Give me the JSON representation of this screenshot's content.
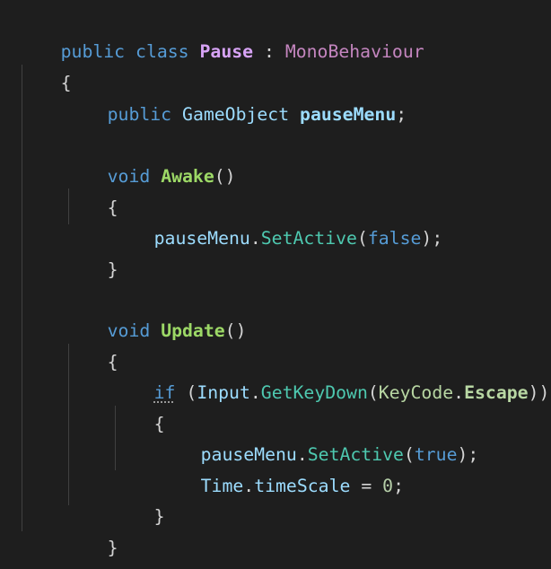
{
  "code": {
    "l1": {
      "t1": "public",
      "t2": "class",
      "t3": "Pause",
      "t4": ":",
      "t5": "MonoBehaviour"
    },
    "l2": {
      "t1": "{"
    },
    "l3": {
      "t1": "public",
      "t2": "GameObject",
      "t3": "pauseMenu",
      "t4": ";"
    },
    "l5": {
      "t1": "void",
      "t2": "Awake",
      "t3": "()"
    },
    "l6": {
      "t1": "{"
    },
    "l7": {
      "t1": "pauseMenu",
      "t2": ".",
      "t3": "SetActive",
      "t4": "(",
      "t5": "false",
      "t6": ");"
    },
    "l8": {
      "t1": "}"
    },
    "l10": {
      "t1": "void",
      "t2": "Update",
      "t3": "()"
    },
    "l11": {
      "t1": "{"
    },
    "l12": {
      "t1": "if",
      "t2": "(",
      "t3": "Input",
      "t4": ".",
      "t5": "GetKeyDown",
      "t6": "(",
      "t7": "KeyCode",
      "t8": ".",
      "t9": "Escape",
      "t10": "))"
    },
    "l13": {
      "t1": "{"
    },
    "l14": {
      "t1": "pauseMenu",
      "t2": ".",
      "t3": "SetActive",
      "t4": "(",
      "t5": "true",
      "t6": ");"
    },
    "l15": {
      "t1": "Time",
      "t2": ".",
      "t3": "timeScale",
      "t4": "=",
      "t5": "0",
      "t6": ";"
    },
    "l16": {
      "t1": "}"
    },
    "l17": {
      "t1": "}"
    },
    "l18": {
      "t1": "}"
    }
  },
  "colors": {
    "background": "#1e1e1e",
    "keyword": "#569cd6",
    "type": "#4ec9b0",
    "method": "#4ec9b0",
    "variable": "#9cdcfe",
    "class_name": "#d7a3f5",
    "punctuation": "#d4d4d4"
  }
}
